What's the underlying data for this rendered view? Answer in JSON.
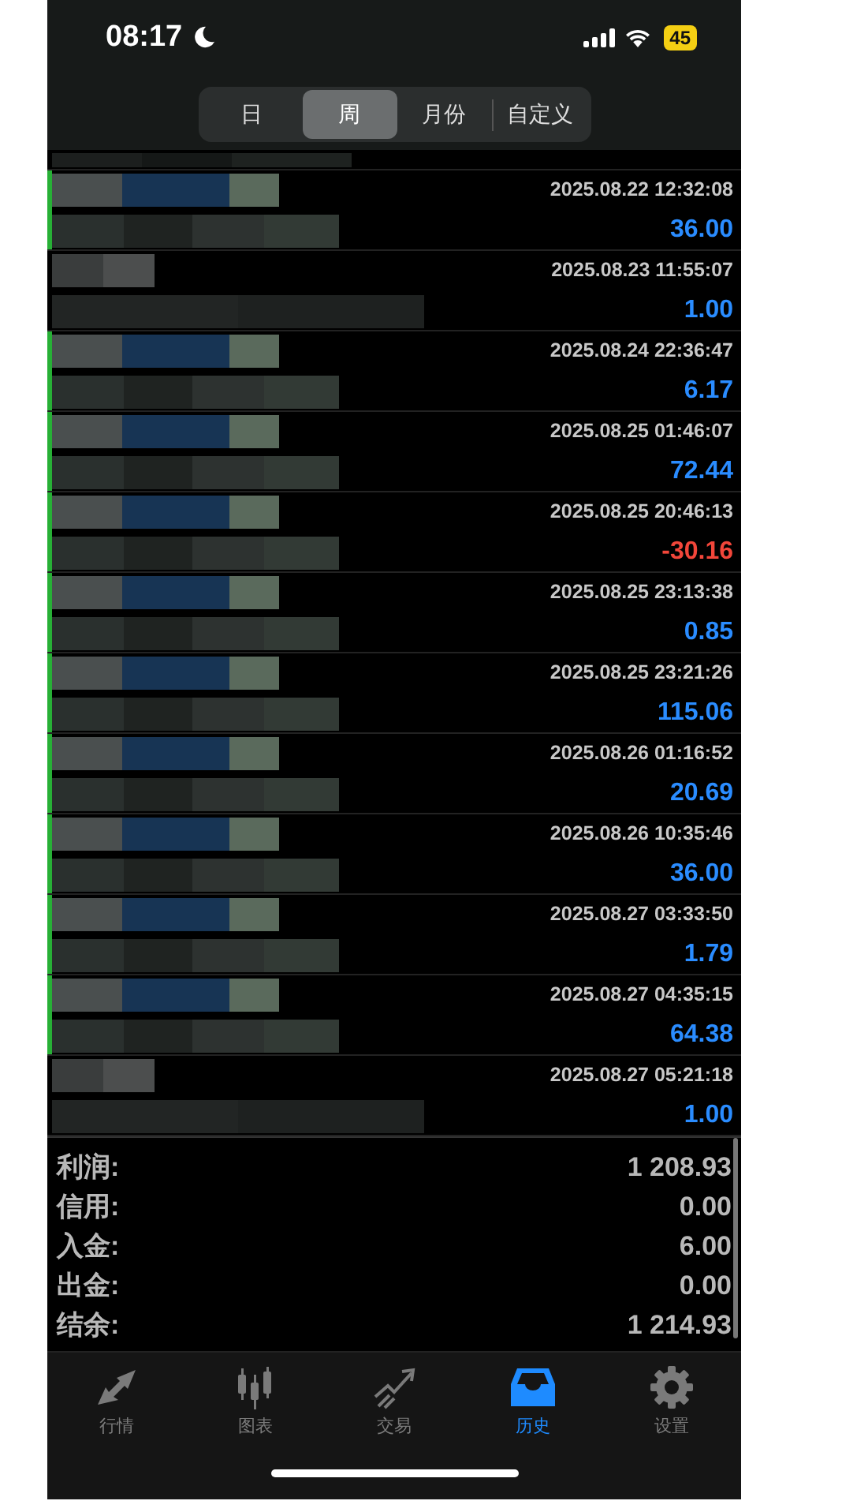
{
  "status_bar": {
    "time": "08:17",
    "battery": "45"
  },
  "segments": [
    {
      "label": "日",
      "selected": false
    },
    {
      "label": "周",
      "selected": true
    },
    {
      "label": "月份",
      "selected": false
    },
    {
      "label": "自定义",
      "selected": false
    }
  ],
  "rows": [
    {
      "kind": "trade",
      "time": "2025.08.22 12:32:08",
      "amount": "36.00",
      "loss": false
    },
    {
      "kind": "balance",
      "time": "2025.08.23 11:55:07",
      "amount": "1.00",
      "loss": false
    },
    {
      "kind": "trade",
      "time": "2025.08.24 22:36:47",
      "amount": "6.17",
      "loss": false
    },
    {
      "kind": "trade",
      "time": "2025.08.25 01:46:07",
      "amount": "72.44",
      "loss": false
    },
    {
      "kind": "trade",
      "time": "2025.08.25 20:46:13",
      "amount": "-30.16",
      "loss": true
    },
    {
      "kind": "trade",
      "time": "2025.08.25 23:13:38",
      "amount": "0.85",
      "loss": false
    },
    {
      "kind": "trade",
      "time": "2025.08.25 23:21:26",
      "amount": "115.06",
      "loss": false
    },
    {
      "kind": "trade",
      "time": "2025.08.26 01:16:52",
      "amount": "20.69",
      "loss": false
    },
    {
      "kind": "trade",
      "time": "2025.08.26 10:35:46",
      "amount": "36.00",
      "loss": false
    },
    {
      "kind": "trade",
      "time": "2025.08.27 03:33:50",
      "amount": "1.79",
      "loss": false
    },
    {
      "kind": "trade",
      "time": "2025.08.27 04:35:15",
      "amount": "64.38",
      "loss": false
    },
    {
      "kind": "balance",
      "time": "2025.08.27 05:21:18",
      "amount": "1.00",
      "loss": false
    }
  ],
  "summary": [
    {
      "label": "利润:",
      "value": "1 208.93"
    },
    {
      "label": "信用:",
      "value": "0.00"
    },
    {
      "label": "入金:",
      "value": "6.00"
    },
    {
      "label": "出金:",
      "value": "0.00"
    },
    {
      "label": "结余:",
      "value": "1 214.93"
    }
  ],
  "tabs": [
    {
      "label": "行情",
      "selected": false
    },
    {
      "label": "图表",
      "selected": false
    },
    {
      "label": "交易",
      "selected": false
    },
    {
      "label": "历史",
      "selected": true
    },
    {
      "label": "设置",
      "selected": false
    }
  ]
}
